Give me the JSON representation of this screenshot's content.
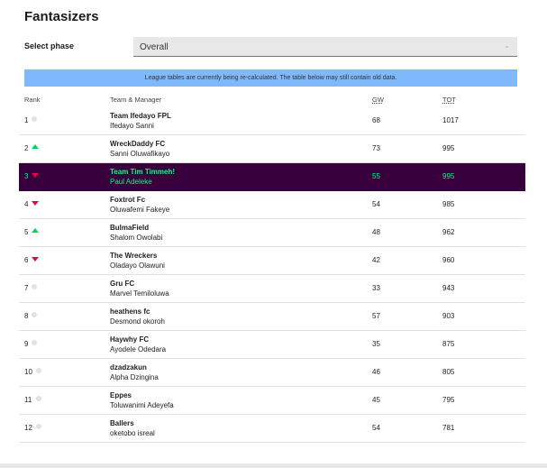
{
  "title": "Fantasizers",
  "phase": {
    "label": "Select phase",
    "value": "Overall"
  },
  "notice": "League tables are currently being re-calculated. The table below may still contain old data.",
  "columns": {
    "rank": "Rank",
    "team": "Team & Manager",
    "gw": "GW",
    "tot": "TOT"
  },
  "colors": {
    "highlight_bg": "#37003c",
    "highlight_text": "#00ff85",
    "up": "#00d75a",
    "down": "#e90052",
    "notice_bg": "#7fb8fb"
  },
  "rows": [
    {
      "rank": "1",
      "move": "same",
      "team": "Team Ifedayo FPL",
      "manager": "Ifedayo Sanni",
      "gw": "68",
      "tot": "1017"
    },
    {
      "rank": "2",
      "move": "up",
      "team": "WreckDaddy FC",
      "manager": "Sanni Oluwafikayo",
      "gw": "73",
      "tot": "995"
    },
    {
      "rank": "3",
      "move": "down",
      "team": "Team Tim Timmeh!",
      "manager": "Paul Adeleke",
      "gw": "55",
      "tot": "995",
      "highlight": true
    },
    {
      "rank": "4",
      "move": "down",
      "team": "Foxtrot Fc",
      "manager": "Oluwafemi Fakeye",
      "gw": "54",
      "tot": "985"
    },
    {
      "rank": "5",
      "move": "up",
      "team": "BulmaField",
      "manager": "Shalom Owolabi",
      "gw": "48",
      "tot": "962"
    },
    {
      "rank": "6",
      "move": "down",
      "team": "The Wreckers",
      "manager": "Oladayo Olawuni",
      "gw": "42",
      "tot": "960"
    },
    {
      "rank": "7",
      "move": "same",
      "team": "Gru FC",
      "manager": "Marvel Temiloluwa",
      "gw": "33",
      "tot": "943"
    },
    {
      "rank": "8",
      "move": "same",
      "team": "heathens fc",
      "manager": "Desmond okoroh",
      "gw": "57",
      "tot": "903"
    },
    {
      "rank": "9",
      "move": "same",
      "team": "Haywhy FC",
      "manager": "Ayodele Odedara",
      "gw": "35",
      "tot": "875"
    },
    {
      "rank": "10",
      "move": "same",
      "team": "dzadzakun",
      "manager": "Alpha Dzingina",
      "gw": "46",
      "tot": "805"
    },
    {
      "rank": "11",
      "move": "same",
      "team": "Eppes",
      "manager": "Toluwanimi Adeyefa",
      "gw": "45",
      "tot": "795"
    },
    {
      "rank": "12",
      "move": "same",
      "team": "Ballers",
      "manager": "oketobo isreal",
      "gw": "54",
      "tot": "781"
    }
  ]
}
